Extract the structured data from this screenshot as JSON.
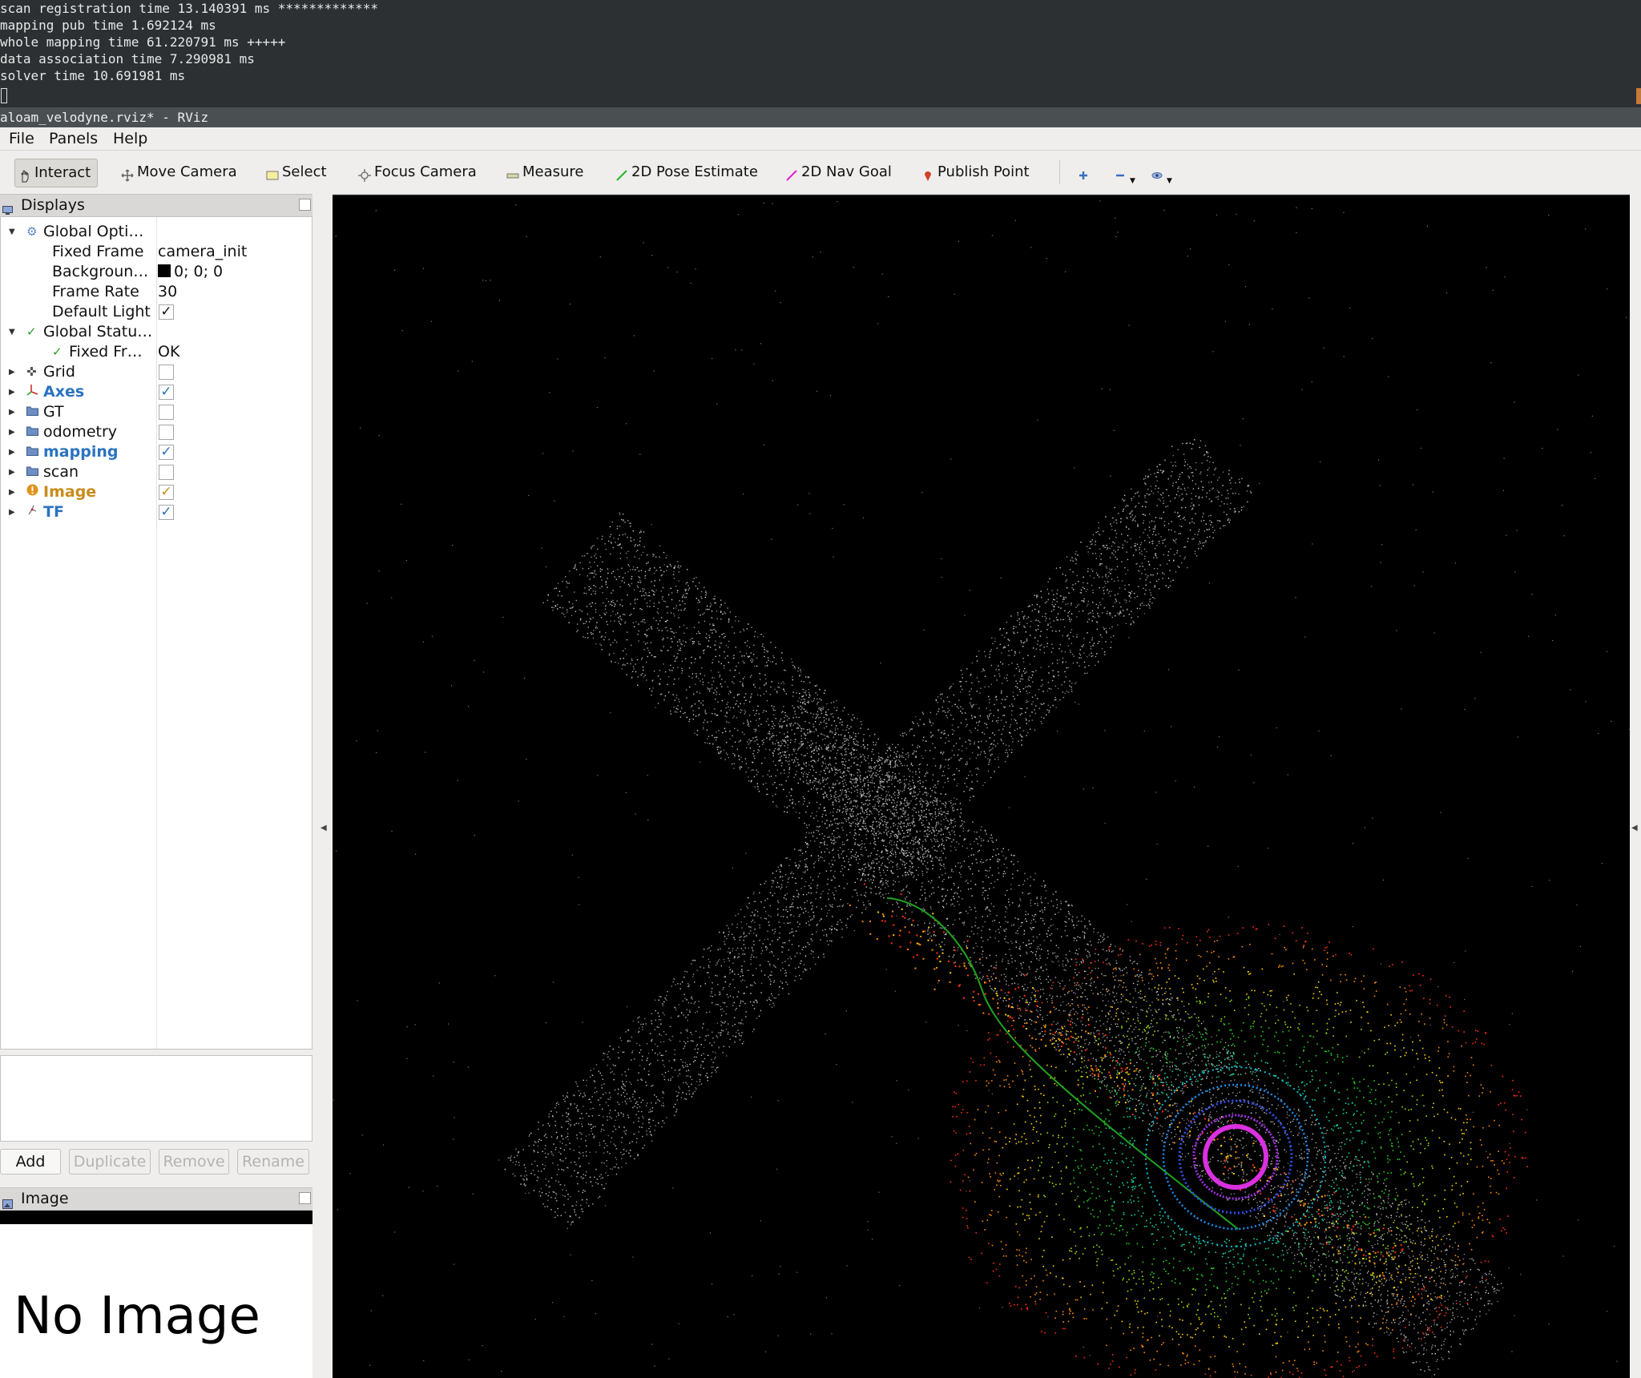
{
  "terminal": {
    "lines": [
      "scan registration time 13.140391 ms *************",
      "mapping pub time 1.692124 ms",
      "whole mapping time 61.220791 ms +++++",
      "data association time 7.290981 ms",
      "solver time 10.691981 ms"
    ]
  },
  "window": {
    "title": "aloam_velodyne.rviz* - RViz"
  },
  "menubar": {
    "file": "File",
    "panels": "Panels",
    "help": "Help"
  },
  "toolbar": {
    "interact": "Interact",
    "move_camera": "Move Camera",
    "select": "Select",
    "focus_camera": "Focus Camera",
    "measure": "Measure",
    "pose_estimate": "2D Pose Estimate",
    "nav_goal": "2D Nav Goal",
    "publish_point": "Publish Point",
    "icons": [
      "plus-icon",
      "minus-icon",
      "eye-icon"
    ]
  },
  "displays": {
    "title": "Displays",
    "global_options": {
      "label": "Global Opti…",
      "fixed_frame_label": "Fixed Frame",
      "fixed_frame_value": "camera_init",
      "background_label": "Backgroun…",
      "background_value": "0; 0; 0",
      "background_color": "#000000",
      "frame_rate_label": "Frame Rate",
      "frame_rate_value": "30",
      "default_light_label": "Default Light",
      "default_light_checked": true
    },
    "global_status": {
      "label": "Global Statu…",
      "fixed_frame_label": "Fixed Fr…",
      "fixed_frame_value": "OK"
    },
    "items": [
      {
        "label": "Grid",
        "checked": false,
        "icon": "grid-icon"
      },
      {
        "label": "Axes",
        "checked": true,
        "icon": "axes-icon",
        "color": "#2a73c0"
      },
      {
        "label": "GT",
        "checked": false,
        "icon": "folder-icon"
      },
      {
        "label": "odometry",
        "checked": false,
        "icon": "folder-icon"
      },
      {
        "label": "mapping",
        "checked": true,
        "icon": "folder-icon",
        "color": "#2a73c0"
      },
      {
        "label": "scan",
        "checked": false,
        "icon": "folder-icon"
      },
      {
        "label": "Image",
        "checked": true,
        "icon": "warning-icon",
        "color": "#c98b1a"
      },
      {
        "label": "TF",
        "checked": true,
        "icon": "tf-icon",
        "color": "#2a73c0"
      }
    ],
    "buttons": {
      "add": "Add",
      "duplicate": "Duplicate",
      "remove": "Remove",
      "rename": "Rename"
    }
  },
  "image_panel": {
    "title": "Image",
    "placeholder": "No Image"
  },
  "colors": {
    "accent_blue": "#2a73c0",
    "warning_orange": "#c98b1a",
    "trajectory_green": "#1fa31f"
  }
}
